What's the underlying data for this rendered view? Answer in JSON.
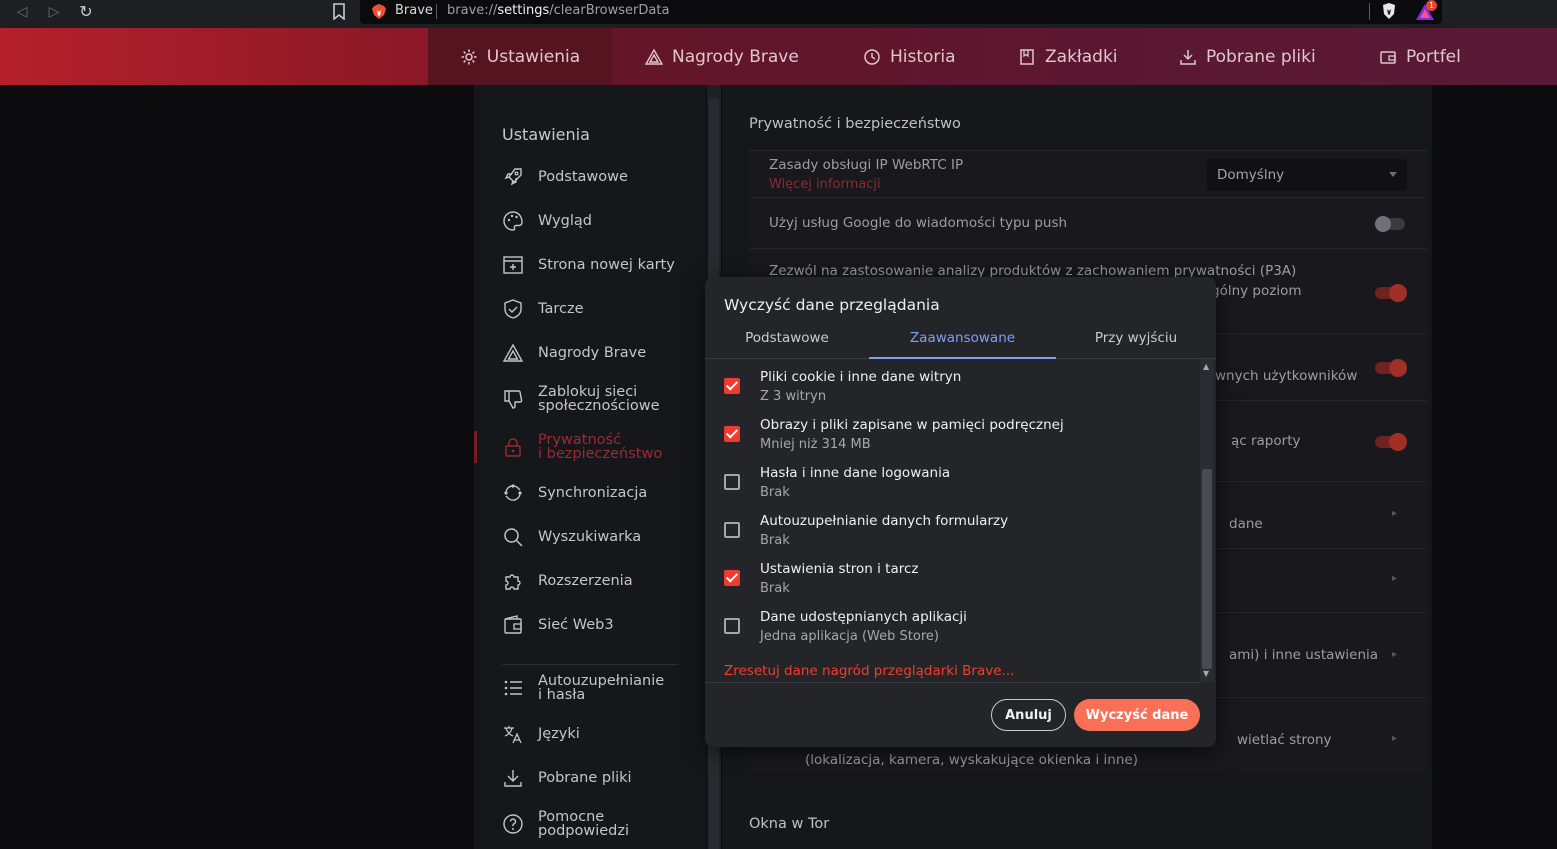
{
  "browser": {
    "app_name": "Brave",
    "url_scheme": "brave://",
    "url_host": "settings",
    "url_path": "/clearBrowserData",
    "rewards_badge": "1"
  },
  "topnav": {
    "items": [
      {
        "label": "Ustawienia",
        "icon": "gear-icon"
      },
      {
        "label": "Nagrody Brave",
        "icon": "rewards-triangle-icon"
      },
      {
        "label": "Historia",
        "icon": "history-icon"
      },
      {
        "label": "Zakładki",
        "icon": "bookmark-icon"
      },
      {
        "label": "Pobrane pliki",
        "icon": "download-icon"
      },
      {
        "label": "Portfel",
        "icon": "wallet-icon"
      }
    ],
    "active_index": 0
  },
  "sidebar": {
    "title": "Ustawienia",
    "items": [
      {
        "label": "Podstawowe",
        "icon": "rocket-icon"
      },
      {
        "label": "Wygląd",
        "icon": "palette-icon"
      },
      {
        "label": "Strona nowej karty",
        "icon": "new-tab-icon"
      },
      {
        "label": "Tarcze",
        "icon": "shield-icon"
      },
      {
        "label": "Nagrody Brave",
        "icon": "rewards-triangle-icon"
      },
      {
        "label_line1": "Zablokuj sieci",
        "label_line2": "społecznościowe",
        "icon": "thumbs-down-icon"
      },
      {
        "label_line1": "Prywatność",
        "label_line2": "i bezpieczeństwo",
        "icon": "lock-icon"
      },
      {
        "label": "Synchronizacja",
        "icon": "sync-icon"
      },
      {
        "label": "Wyszukiwarka",
        "icon": "search-icon"
      },
      {
        "label": "Rozszerzenia",
        "icon": "puzzle-icon"
      },
      {
        "label": "Sieć Web3",
        "icon": "wallet-icon"
      },
      {
        "label_line1": "Autouzupełnianie",
        "label_line2": "i hasła",
        "icon": "list-icon"
      },
      {
        "label": "Języki",
        "icon": "translate-icon"
      },
      {
        "label": "Pobrane pliki",
        "icon": "download-icon"
      },
      {
        "label_line1": "Pomocne",
        "label_line2": "podpowiedzi",
        "icon": "help-icon"
      }
    ],
    "active_index": 6
  },
  "content": {
    "section_title": "Prywatność i bezpieczeństwo",
    "webrtc_label": "Zasady obsługi IP WebRTC IP",
    "webrtc_link": "Więcej informacji",
    "webrtc_value": "Domyślny",
    "push_label": "Użyj usług Google do wiadomości typu push",
    "push_enabled": false,
    "p3a_label": "Zezwól na zastosowanie analizy produktów z zachowaniem prywatności (P3A)",
    "p3a_sub_partial": "gólny poziom",
    "p3a_enabled": true,
    "row3_partial": "wnych użytkowników",
    "row3_enabled": true,
    "row4_partial": "ąc raporty",
    "row4_enabled": true,
    "row5_partial": "dane",
    "row7_partial": "ami) i inne ustawienia",
    "row8_partial": "wietlać strony",
    "row8_sub": "(lokalizacja, kamera, wyskakujące okienka i inne)",
    "section2_title": "Okna w Tor"
  },
  "dialog": {
    "title": "Wyczyść dane przeglądania",
    "tabs": [
      "Podstawowe",
      "Zaawansowane",
      "Przy wyjściu"
    ],
    "active_tab": 1,
    "options": [
      {
        "title": "Pliki cookie i inne dane witryn",
        "subtitle": "Z 3 witryn",
        "checked": true
      },
      {
        "title": "Obrazy i pliki zapisane w pamięci podręcznej",
        "subtitle": "Mniej niż 314 MB",
        "checked": true
      },
      {
        "title": "Hasła i inne dane logowania",
        "subtitle": "Brak",
        "checked": false
      },
      {
        "title": "Autouzupełnianie danych formularzy",
        "subtitle": "Brak",
        "checked": false
      },
      {
        "title": "Ustawienia stron i tarcz",
        "subtitle": "Brak",
        "checked": true
      },
      {
        "title": "Dane udostępnianych aplikacji",
        "subtitle": "Jedna aplikacja (Web Store)",
        "checked": false
      }
    ],
    "reset_link": "Zresetuj dane nagród przeglądarki Brave...",
    "cancel_label": "Anuluj",
    "clear_label": "Wyczyść dane"
  }
}
